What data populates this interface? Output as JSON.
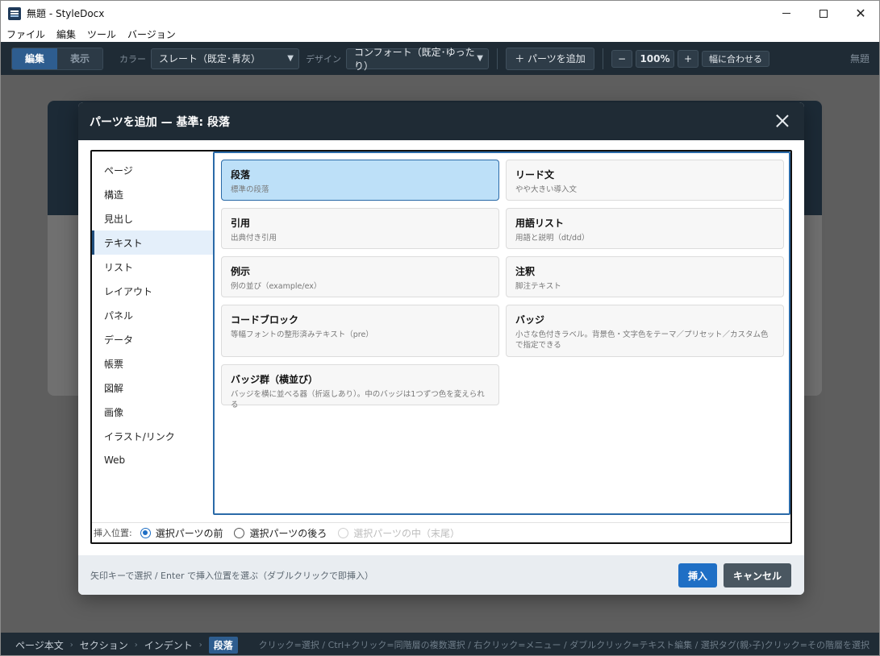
{
  "window": {
    "title": "無題 - StyleDocx",
    "icon": "app-icon",
    "minimize_icon": "minimize-icon",
    "maximize_icon": "maximize-icon",
    "close_icon": "close-icon"
  },
  "menubar": {
    "items": [
      "ファイル",
      "編集",
      "ツール",
      "バージョン"
    ]
  },
  "toolbar": {
    "mode_edit": "編集",
    "mode_view": "表示",
    "color_label": "カラー",
    "color_value": "スレート（既定･青灰）",
    "design_label": "デザイン",
    "design_value": "コンフォート（既定･ゆったり）",
    "add_part": "＋ パーツを追加",
    "zoom_minus": "−",
    "zoom_value": "100%",
    "zoom_plus": "+",
    "fit_width": "幅に合わせる",
    "doc_name": "無題"
  },
  "dialog": {
    "title": "パーツを追加 — 基準: 段落",
    "categories": [
      "ページ",
      "構造",
      "見出し",
      "テキスト",
      "リスト",
      "レイアウト",
      "パネル",
      "データ",
      "帳票",
      "図解",
      "画像",
      "イラスト/リンク",
      "Web"
    ],
    "active_category": "テキスト",
    "parts": [
      {
        "title": "段落",
        "desc": "標準の段落",
        "selected": true
      },
      {
        "title": "リード文",
        "desc": "やや大きい導入文"
      },
      {
        "title": "引用",
        "desc": "出典付き引用"
      },
      {
        "title": "用語リスト",
        "desc": "用語と説明（dt/dd）"
      },
      {
        "title": "例示",
        "desc": "例の並び（example/ex）"
      },
      {
        "title": "注釈",
        "desc": "脚注テキスト"
      },
      {
        "title": "コードブロック",
        "desc": "等幅フォントの整形済みテキスト（pre）"
      },
      {
        "title": "バッジ",
        "desc": "小さな色付きラベル。背景色・文字色をテーマ／プリセット／カスタム色で指定できる"
      },
      {
        "title": "バッジ群（横並び）",
        "desc": "バッジを横に並べる器（折返しあり）。中のバッジは1つずつ色を変えられる"
      }
    ],
    "insert_label": "挿入位置:",
    "insert_options": [
      "選択パーツの前",
      "選択パーツの後ろ",
      "選択パーツの中（末尾）"
    ],
    "hint": "矢印キーで選択 / Enter で挿入位置を選ぶ（ダブルクリックで即挿入）",
    "insert_button": "挿入",
    "cancel_button": "キャンセル"
  },
  "statusbar": {
    "breadcrumbs": [
      "ページ本文",
      "セクション",
      "インデント",
      "段落"
    ],
    "hint": "クリック=選択 / Ctrl+クリック=同階層の複数選択 / 右クリック=メニュー / ダブルクリック=テキスト編集 / 選択タグ(親›子)クリック=その階層を選択"
  },
  "colors": {
    "toolbar_bg": "#1f2b35",
    "accent": "#2e5d8f",
    "primary_button": "#1f6fc5",
    "selected_card": "#bde0f8"
  }
}
